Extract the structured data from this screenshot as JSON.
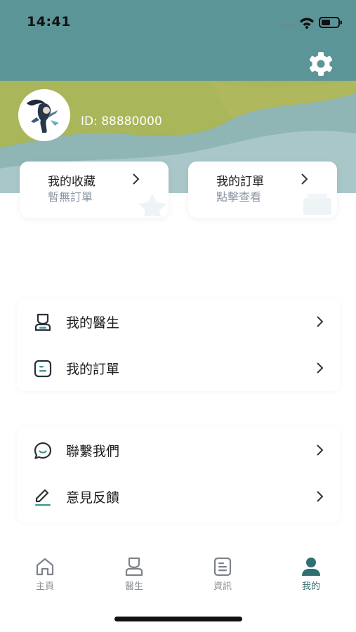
{
  "status_bar": {
    "time": "14:41"
  },
  "profile": {
    "id_text": "ID: 88880000"
  },
  "cards": [
    {
      "title": "我的收藏",
      "subtitle": "暫無訂單"
    },
    {
      "title": "我的訂單",
      "subtitle": "點擊查看"
    }
  ],
  "menu_group_1": [
    {
      "label": "我的醫生",
      "icon": "doctor-icon"
    },
    {
      "label": "我的訂單",
      "icon": "order-icon"
    }
  ],
  "menu_group_2": [
    {
      "label": "聯繫我們",
      "icon": "chat-icon"
    },
    {
      "label": "意見反饋",
      "icon": "feedback-pen-icon"
    }
  ],
  "tabbar": [
    {
      "label": "主頁",
      "icon": "home-icon"
    },
    {
      "label": "醫生",
      "icon": "doctor-icon"
    },
    {
      "label": "資訊",
      "icon": "news-icon"
    },
    {
      "label": "我的",
      "icon": "profile-icon",
      "active": true
    }
  ],
  "colors": {
    "header": "#5b9597",
    "wave_light": "#9dc0c1",
    "wave_yellow": "#b6b75c",
    "accent": "#2f6f70",
    "muted": "#8e97a6"
  }
}
